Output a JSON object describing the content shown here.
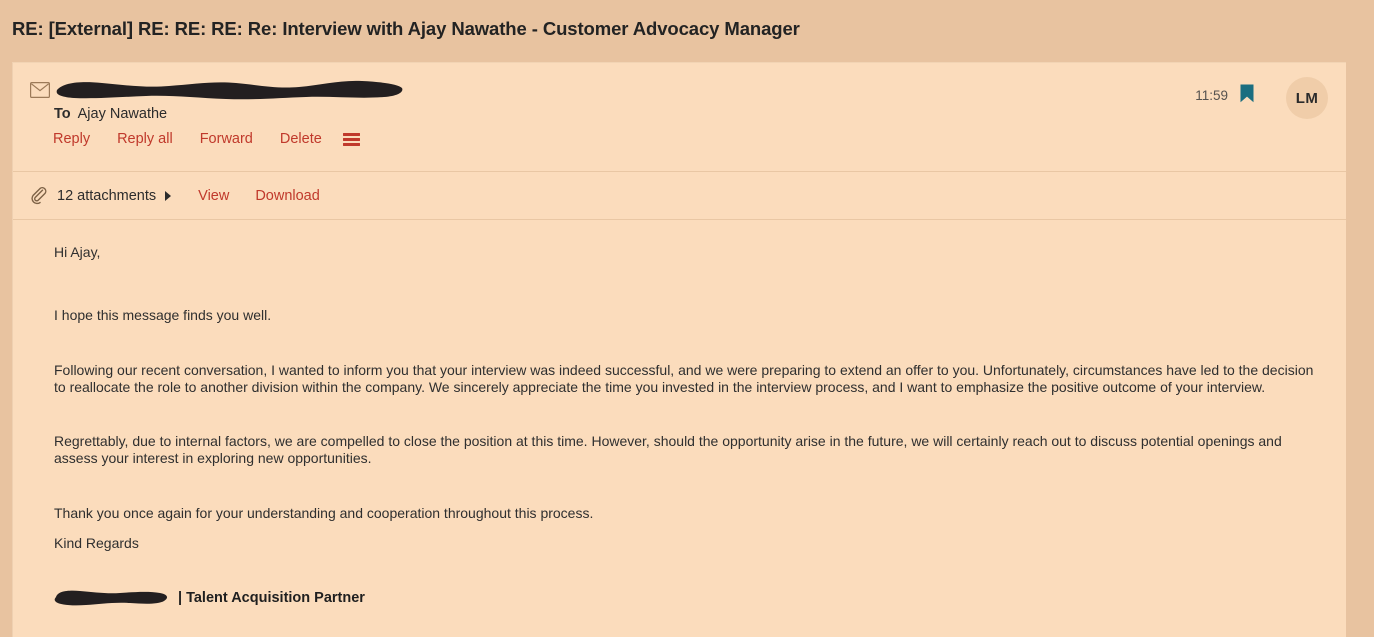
{
  "subject": {
    "title": "RE: [External] RE: RE: RE: Re: Interview with Ajay Nawathe - Customer Advocacy Manager"
  },
  "message_header": {
    "envelope_icon": "envelope-icon",
    "sender_redacted": true,
    "to_label": "To",
    "to_recipient": "Ajay Nawathe",
    "actions": [
      {
        "label": "Reply",
        "name": "reply-link"
      },
      {
        "label": "Reply all",
        "name": "reply-all-link"
      },
      {
        "label": "Forward",
        "name": "forward-link"
      },
      {
        "label": "Delete",
        "name": "delete-link"
      }
    ],
    "more_actions_icon": "hamburger-menu-icon",
    "time": "11:59",
    "flag_icon": "bookmark-flag-icon",
    "flag_color": "#1b6e80",
    "avatar_initials": "LM"
  },
  "attachments": {
    "paperclip_icon": "paperclip-icon",
    "count_label": "12 attachments",
    "expander_icon": "triangle-right-icon",
    "view_label": "View",
    "download_label": "Download"
  },
  "body": {
    "greeting": "Hi Ajay,",
    "paragraph_1": "I hope this message finds you well.",
    "paragraph_2": "Following our recent conversation, I wanted to inform you that your interview was indeed successful, and we were preparing to extend an offer to you. Unfortunately, circumstances have led to the decision to reallocate the role to another division within the company. We sincerely appreciate the time you invested in the interview process, and I want to emphasize the positive outcome of your interview.",
    "paragraph_3": "Regrettably, due to internal factors, we are compelled to close the position at this time. However, should the opportunity arise in the future, we will certainly reach out to discuss potential openings and assess your interest in exploring new opportunities.",
    "paragraph_4": "Thank you once again for your understanding and cooperation throughout this process.",
    "sign_off": "Kind Regards",
    "signature_name_redacted": true,
    "signature_role": "| Talent Acquisition Partner"
  },
  "colors": {
    "page_background": "#e8c3a0",
    "pane_background": "#fbdcbc",
    "link_red": "#c0392b",
    "text_dark": "#2f2f2f",
    "flag_teal": "#1b6e80",
    "redaction_black": "#231f20"
  }
}
